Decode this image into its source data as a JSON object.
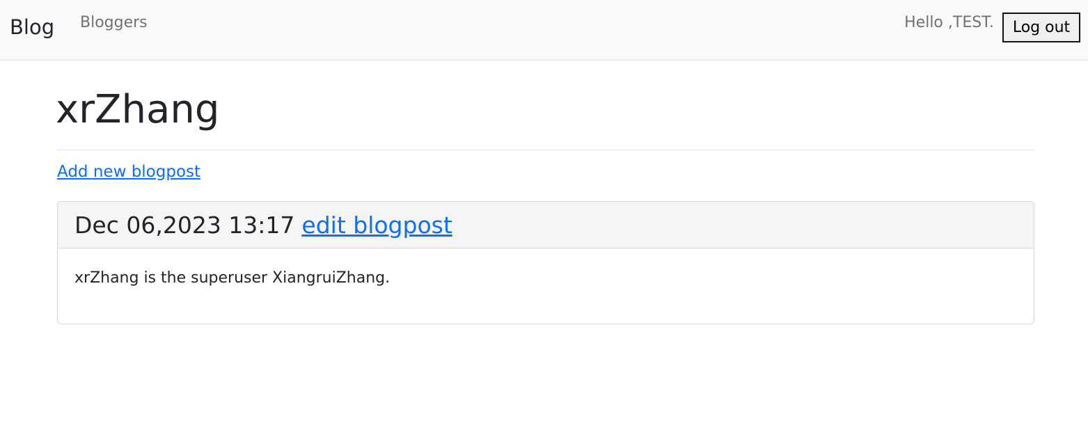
{
  "navbar": {
    "brand": "Blog",
    "links": [
      {
        "label": "Bloggers"
      }
    ],
    "greeting": "Hello ,TEST.",
    "logout_label": "Log out"
  },
  "page": {
    "title": "xrZhang",
    "add_post_link": "Add new blogpost"
  },
  "posts": [
    {
      "date": "Dec 06,2023 13:17",
      "edit_label": "edit blogpost",
      "body": "xrZhang is the superuser XiangruiZhang."
    }
  ]
}
